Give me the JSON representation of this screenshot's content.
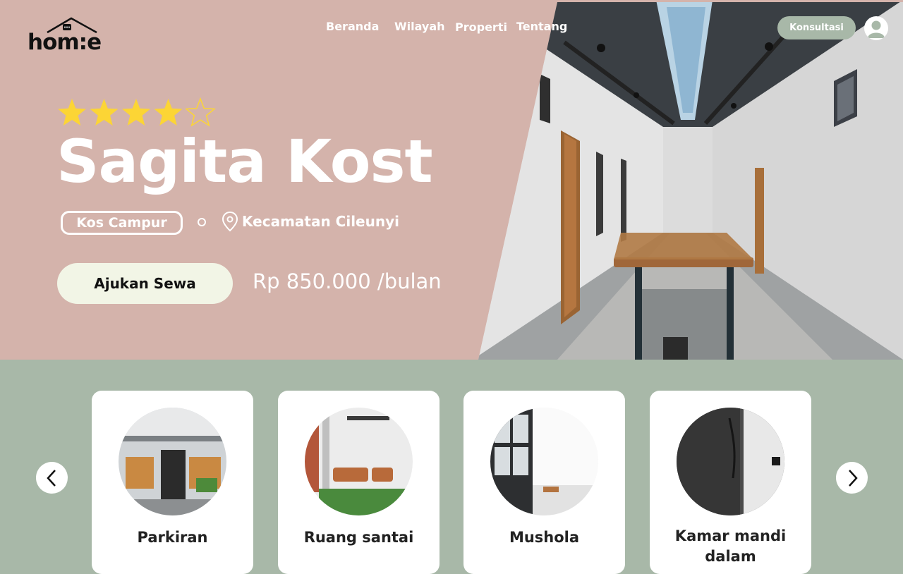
{
  "brand": {
    "logo_text": "hom:e"
  },
  "nav": {
    "items": [
      "Beranda",
      "Wilayah",
      "Properti",
      "Tentang"
    ],
    "consult_label": "Konsultasi"
  },
  "hero": {
    "rating": 4,
    "rating_max": 5,
    "title": "Sagita Kost",
    "type_tag": "Kos Campur",
    "location": "Kecamatan Cileunyi",
    "cta_label": "Ajukan Sewa",
    "price": "Rp 850.000 /bulan"
  },
  "facilities": [
    {
      "label": "Parkiran"
    },
    {
      "label": "Ruang santai"
    },
    {
      "label": "Mushola"
    },
    {
      "label": "Kamar mandi dalam"
    }
  ],
  "colors": {
    "hero_bg": "#d4b3ab",
    "section_bg": "#a8b8a8",
    "cta_bg": "#f2f5e6",
    "star": "#fcd535"
  }
}
